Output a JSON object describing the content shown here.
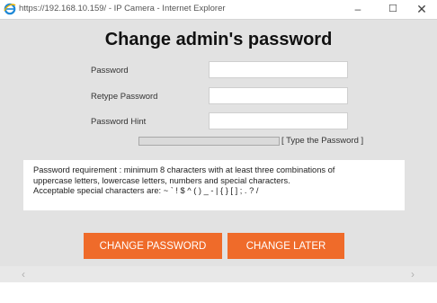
{
  "window": {
    "title": "https://192.168.10.159/ - IP Camera - Internet Explorer",
    "minimize_glyph": "–",
    "maximize_glyph": "☐",
    "close_glyph": "✕",
    "browser_icon": "internet-explorer-icon"
  },
  "dialog": {
    "heading": "Change admin's password",
    "fields": [
      {
        "label": "Password",
        "value": "",
        "placeholder": ""
      },
      {
        "label": "Retype Password",
        "value": "",
        "placeholder": ""
      },
      {
        "label": "Password Hint",
        "value": "",
        "placeholder": ""
      }
    ],
    "strength": {
      "text": "[ Type the Password ]",
      "level_fraction": 0
    },
    "requirements": [
      "Password requirement : minimum 8 characters with at least three combinations of",
      "uppercase letters, lowercase letters, numbers and special characters.",
      "Acceptable special characters are: ~ ` ! $ ^ ( ) _ - | { } [ ] ; . ? /"
    ],
    "buttons": {
      "change_label": "CHANGE PASSWORD",
      "later_label": "CHANGE LATER"
    }
  },
  "scrollbar": {
    "left_glyph": "‹",
    "right_glyph": "›"
  },
  "colors": {
    "accent_button": "#ef6b2a",
    "dialog_background": "#e2e2e2"
  }
}
